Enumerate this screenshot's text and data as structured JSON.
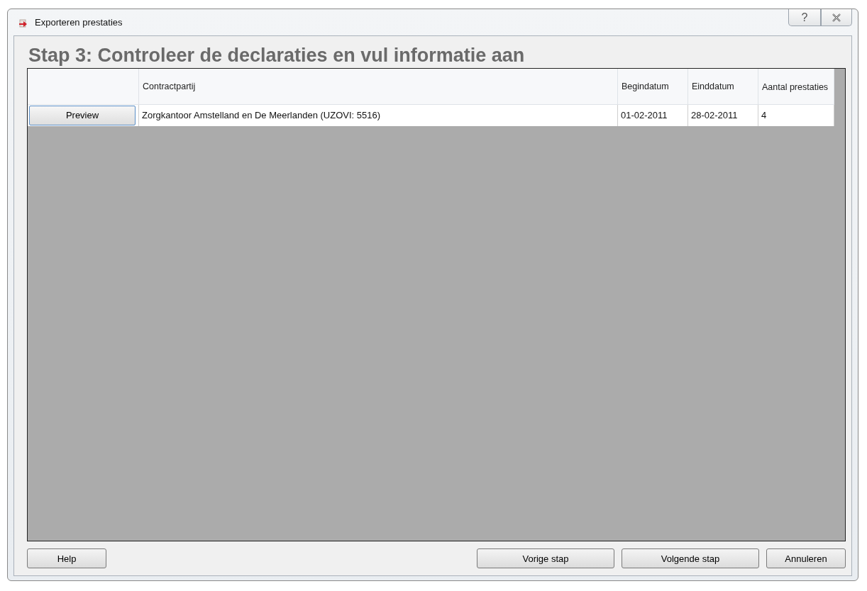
{
  "window": {
    "title": "Exporteren prestaties",
    "help_glyph": "?"
  },
  "heading": "Stap 3: Controleer de declaraties en vul informatie aan",
  "table": {
    "columns": [
      "Contractpartij",
      "Begindatum",
      "Einddatum",
      "Aantal prestaties"
    ],
    "rows": [
      {
        "button": "Preview",
        "cells": [
          "Zorgkantoor Amstelland en De Meerlanden (UZOVI: 5516)",
          "01-02-2011",
          "28-02-2011",
          "4"
        ]
      }
    ]
  },
  "buttons_left": [
    "Help"
  ],
  "buttons_right": [
    "Vorige stap",
    "Volgende stap",
    "Annuleren"
  ]
}
